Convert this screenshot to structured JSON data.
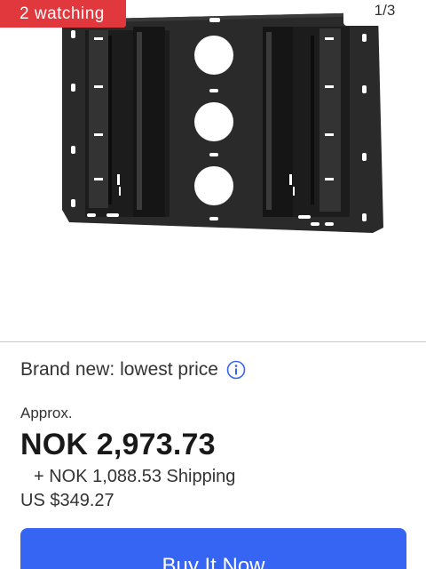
{
  "gallery": {
    "watchers_badge": "2 watching",
    "image_counter": "1/3",
    "image_icon": "tv-wall-mount-bracket-image"
  },
  "listing": {
    "condition_label": "Brand new: lowest price",
    "info_icon": "info-icon",
    "approx_label": "Approx.",
    "price": "NOK 2,973.73",
    "shipping": "+ NOK 1,088.53 Shipping",
    "usd_price": "US $349.27"
  },
  "actions": {
    "buy_now_label": "Buy It Now"
  },
  "colors": {
    "badge_red": "#e0383d",
    "buy_button_blue": "#3665f3",
    "info_icon_blue": "#3665f3"
  }
}
